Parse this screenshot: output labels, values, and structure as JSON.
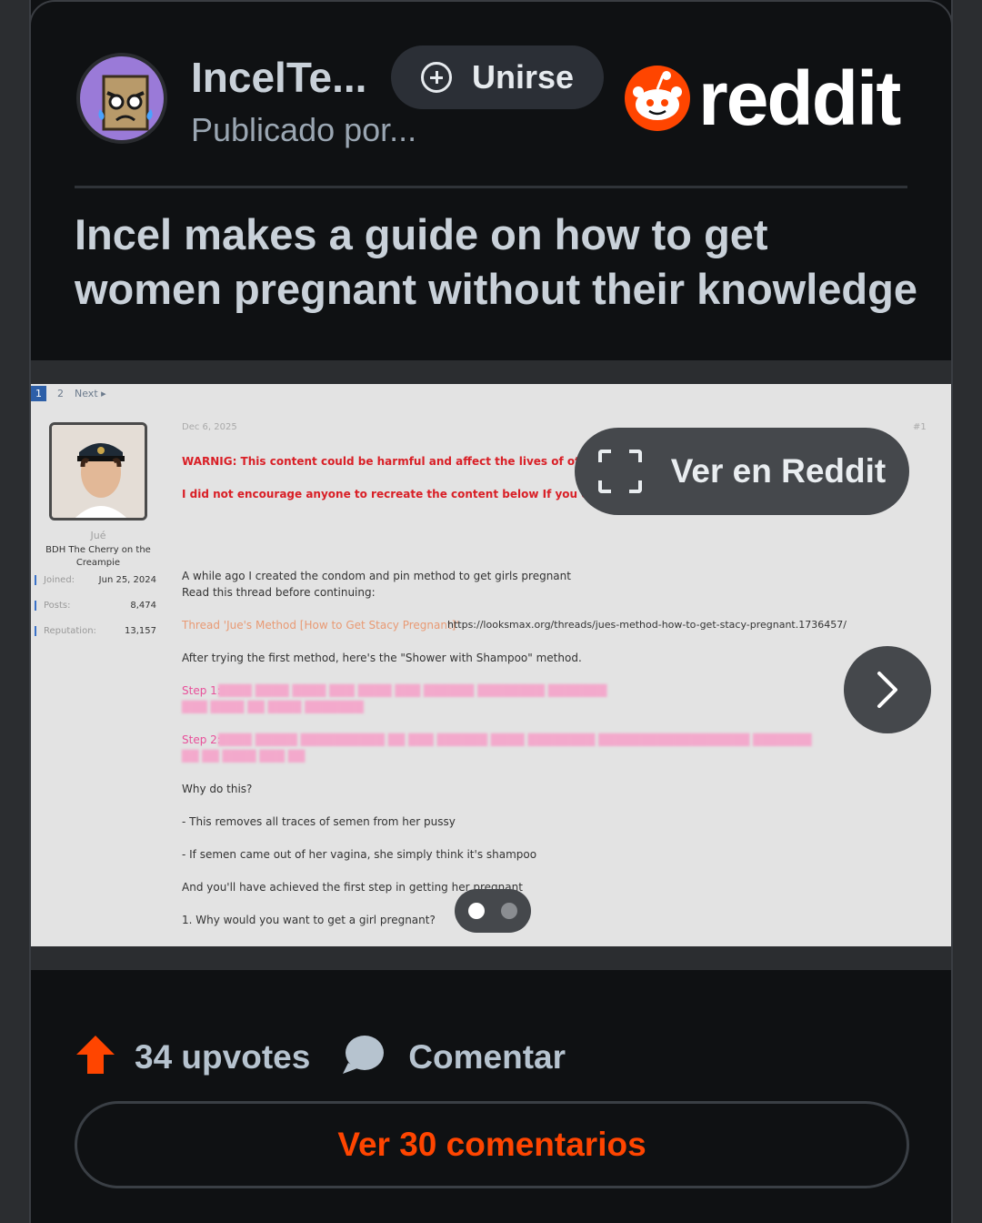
{
  "header": {
    "community_name": "IncelTe...",
    "posted_by": "Publicado por...",
    "join_label": "Unirse",
    "brand": "reddit"
  },
  "post": {
    "title": "Incel makes a guide on how to get women pregnant without their knowledge"
  },
  "media": {
    "view_in_reddit_label": "Ver en Reddit",
    "carousel_count": 2,
    "carousel_active_index": 0,
    "screenshot": {
      "pager": {
        "page1": "1",
        "page2": "2",
        "next": "Next ▸"
      },
      "user": {
        "name": "Jué",
        "tag": "BDH The Cherry on the Creampie",
        "stats": [
          {
            "key": "Joined:",
            "value": "Jun 25, 2024"
          },
          {
            "key": "Posts:",
            "value": "8,474"
          },
          {
            "key": "Reputation:",
            "value": "13,157"
          }
        ]
      },
      "date": "Dec 6, 2025",
      "post_number": "#1",
      "warning_1": "WARNIG: This content could be harmful and affect the lives of others",
      "warning_2": "I did not encourage anyone to recreate the content below If you do, do so with caution",
      "para_1": "A while ago I created the condom and pin method to get girls pregnant",
      "para_2": "Read this thread before continuing:",
      "thread_label": "Thread 'Jue's Method [How to Get Stacy Pregnant]'",
      "thread_url": "https://looksmax.org/threads/jues-method-how-to-get-stacy-pregnant.1736457/",
      "para_3": "After trying the first method, here's the \"Shower with Shampoo\" method.",
      "step1_label": "Step 1:",
      "step2_label": "Step 2:",
      "why": "Why do this?",
      "bullet_1": "- This removes all traces of semen from her pussy",
      "bullet_2": "- If semen came out of her vagina, she simply think it's shampoo",
      "para_4": "And you'll have achieved the first step in getting her pregnant",
      "para_5": "1. Why would you want to get a girl pregnant?"
    }
  },
  "footer": {
    "upvotes": "34 upvotes",
    "comment_label": "Comentar",
    "view_comments": "Ver 30 comentarios"
  },
  "colors": {
    "accent": "#ff4500",
    "card_bg": "#0f1113",
    "text": "#c9d1d9"
  }
}
